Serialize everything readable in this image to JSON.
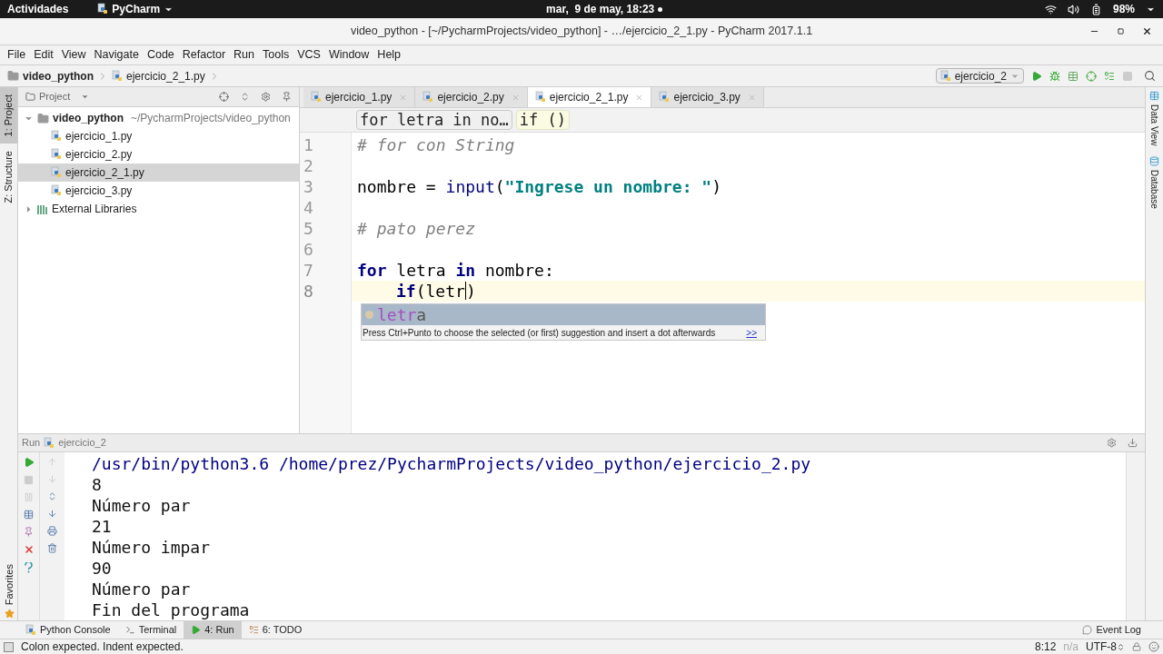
{
  "top_bar": {
    "activities": "Actividades",
    "app_menu": "PyCharm",
    "clock": "mar,  9 de may, 18:23",
    "battery": "98%"
  },
  "window": {
    "title": "video_python - [~/PycharmProjects/video_python] - …/ejercicio_2_1.py - PyCharm 2017.1.1"
  },
  "menu": [
    "File",
    "Edit",
    "View",
    "Navigate",
    "Code",
    "Refactor",
    "Run",
    "Tools",
    "VCS",
    "Window",
    "Help"
  ],
  "navbar": {
    "crumbs": [
      {
        "kind": "folder",
        "label": "video_python"
      },
      {
        "kind": "file",
        "label": "ejercicio_2_1.py"
      }
    ],
    "run_config": "ejercicio_2"
  },
  "left_strip": [
    {
      "label": "1: Project",
      "selected": true
    },
    {
      "label": "Z: Structure",
      "selected": false
    }
  ],
  "favorites": "Favorites",
  "right_strip": [
    "Data View",
    "Database"
  ],
  "project_panel": {
    "title": "Project",
    "tree": [
      {
        "label": "video_python",
        "path": "~/PycharmProjects/video_python",
        "kind": "folder",
        "expanded": true,
        "selected": false,
        "children": [
          {
            "label": "ejercicio_1.py",
            "kind": "file",
            "selected": false
          },
          {
            "label": "ejercicio_2.py",
            "kind": "file",
            "selected": false
          },
          {
            "label": "ejercicio_2_1.py",
            "kind": "file",
            "selected": true
          },
          {
            "label": "ejercicio_3.py",
            "kind": "file",
            "selected": false
          }
        ]
      },
      {
        "label": "External Libraries",
        "kind": "library",
        "expanded": false,
        "selected": false
      }
    ]
  },
  "editor_tabs": [
    {
      "label": "ejercicio_1.py",
      "selected": false
    },
    {
      "label": "ejercicio_2.py",
      "selected": false
    },
    {
      "label": "ejercicio_2_1.py",
      "selected": true
    },
    {
      "label": "ejercicio_3.py",
      "selected": false
    }
  ],
  "editor_breadcrumbs": [
    {
      "label": "for letra in no…",
      "selected": false
    },
    {
      "label": "if ()",
      "selected": true
    }
  ],
  "code": [
    {
      "number": "1",
      "current": false,
      "tokens": [
        {
          "kind": "comment",
          "text": "# for con String"
        }
      ]
    },
    {
      "number": "2",
      "current": false
    },
    {
      "number": "3",
      "current": false,
      "tokens": [
        {
          "kind": "plain",
          "text": "nombre = "
        },
        {
          "kind": "builtin",
          "text": "input"
        },
        {
          "kind": "plain",
          "text": "("
        },
        {
          "kind": "string",
          "text": "\"Ingrese un nombre: \""
        },
        {
          "kind": "plain",
          "text": ")"
        }
      ]
    },
    {
      "number": "4",
      "current": false
    },
    {
      "number": "5",
      "current": false,
      "tokens": [
        {
          "kind": "comment",
          "text": "# pato perez"
        }
      ]
    },
    {
      "number": "6",
      "current": false
    },
    {
      "number": "7",
      "current": false,
      "tokens": [
        {
          "kind": "keyword",
          "text": "for"
        },
        {
          "kind": "plain",
          "text": " letra "
        },
        {
          "kind": "keyword",
          "text": "in"
        },
        {
          "kind": "plain",
          "text": " nombre:"
        }
      ]
    },
    {
      "number": "8",
      "current": true,
      "indented": true,
      "tokens": [
        {
          "kind": "keyword",
          "text": "if"
        },
        {
          "kind": "plain",
          "text": "(letr",
          "caret": true
        },
        {
          "kind": "plain",
          "text": ")"
        }
      ]
    }
  ],
  "completion": {
    "items": [
      {
        "match": "letr",
        "rest": "a",
        "selected": true
      }
    ],
    "hint": "Press Ctrl+Punto to choose the selected (or first) suggestion and insert a dot afterwards",
    "hint_link": ">>"
  },
  "run_panel": {
    "label": "Run",
    "config": "ejercicio_2",
    "output": [
      {
        "kind": "command",
        "text": "/usr/bin/python3.6 /home/prez/PycharmProjects/video_python/ejercicio_2.py"
      },
      {
        "kind": "stdout",
        "text": "8"
      },
      {
        "kind": "stdout",
        "text": "Número par"
      },
      {
        "kind": "stdout",
        "text": "21"
      },
      {
        "kind": "stdout",
        "text": "Número impar"
      },
      {
        "kind": "stdout",
        "text": "90"
      },
      {
        "kind": "stdout",
        "text": "Número par"
      },
      {
        "kind": "stdout",
        "text": "Fin del programa"
      }
    ]
  },
  "tool_windows": [
    {
      "label": "Python Console",
      "kind": "python",
      "selected": false
    },
    {
      "label": "Terminal",
      "kind": "terminal",
      "selected": false
    },
    {
      "label": "4: Run",
      "kind": "run",
      "selected": true
    },
    {
      "label": "6: TODO",
      "kind": "todo",
      "selected": false
    }
  ],
  "event_log": "Event Log",
  "status_bar": {
    "message": "Colon expected. Indent expected.",
    "position": "8:12",
    "separator": "n/a",
    "encoding": "UTF-8"
  }
}
